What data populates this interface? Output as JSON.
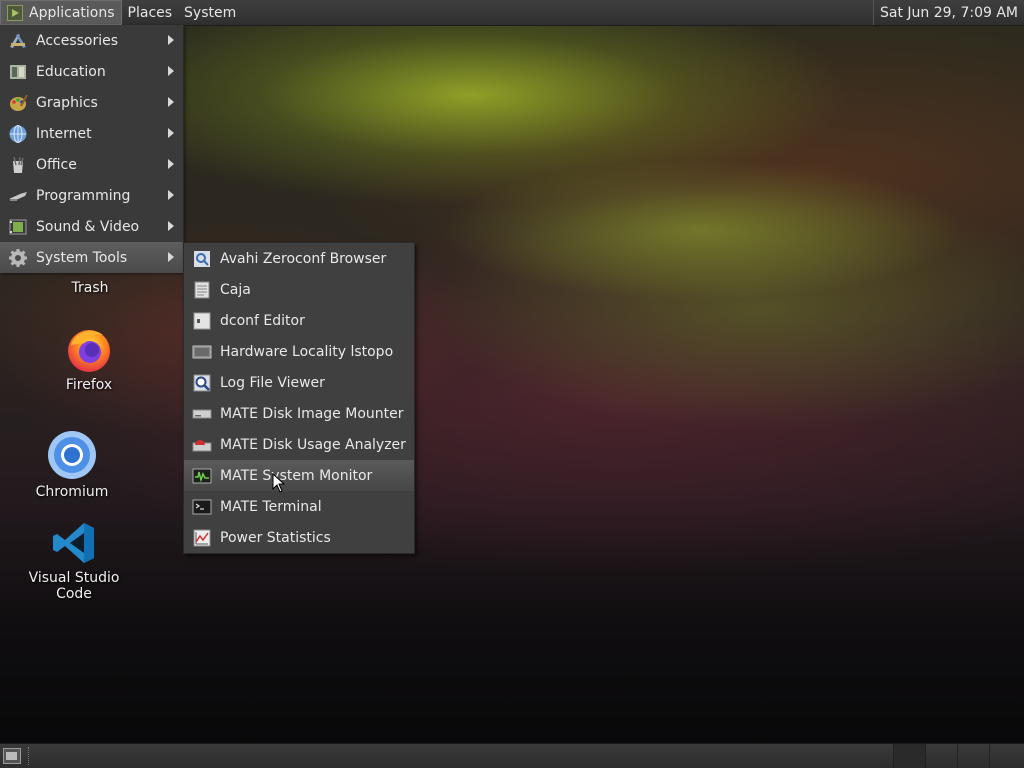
{
  "top_panel": {
    "applications": "Applications",
    "places": "Places",
    "system": "System",
    "clock": "Sat Jun 29,  7:09 AM"
  },
  "applications_menu": {
    "items": [
      {
        "label": "Accessories",
        "icon": "accessories-icon"
      },
      {
        "label": "Education",
        "icon": "education-icon"
      },
      {
        "label": "Graphics",
        "icon": "graphics-icon"
      },
      {
        "label": "Internet",
        "icon": "internet-icon"
      },
      {
        "label": "Office",
        "icon": "office-icon"
      },
      {
        "label": "Programming",
        "icon": "programming-icon"
      },
      {
        "label": "Sound & Video",
        "icon": "sound-video-icon"
      },
      {
        "label": "System Tools",
        "icon": "gear-icon",
        "selected": true
      }
    ]
  },
  "system_tools_submenu": {
    "items": [
      {
        "label": "Avahi Zeroconf Browser",
        "icon": "network-browser-icon"
      },
      {
        "label": "Caja",
        "icon": "file-manager-icon"
      },
      {
        "label": "dconf Editor",
        "icon": "dconf-editor-icon"
      },
      {
        "label": "Hardware Locality lstopo",
        "icon": "hardware-icon"
      },
      {
        "label": "Log File Viewer",
        "icon": "log-viewer-icon"
      },
      {
        "label": "MATE Disk Image Mounter",
        "icon": "disk-mounter-icon"
      },
      {
        "label": "MATE Disk Usage Analyzer",
        "icon": "disk-usage-icon"
      },
      {
        "label": "MATE System Monitor",
        "icon": "system-monitor-icon",
        "hovered": true
      },
      {
        "label": "MATE Terminal",
        "icon": "terminal-icon"
      },
      {
        "label": "Power Statistics",
        "icon": "power-statistics-icon"
      }
    ]
  },
  "desktop": {
    "trash": "Trash",
    "firefox": "Firefox",
    "chromium": "Chromium",
    "vscode": "Visual Studio Code"
  },
  "colors": {
    "panel_bg": "#333333",
    "menu_bg": "#3a3a3a",
    "highlight": "#555555",
    "vscode_blue": "#2489ca",
    "chromium_blue": "#3d7fd6"
  }
}
